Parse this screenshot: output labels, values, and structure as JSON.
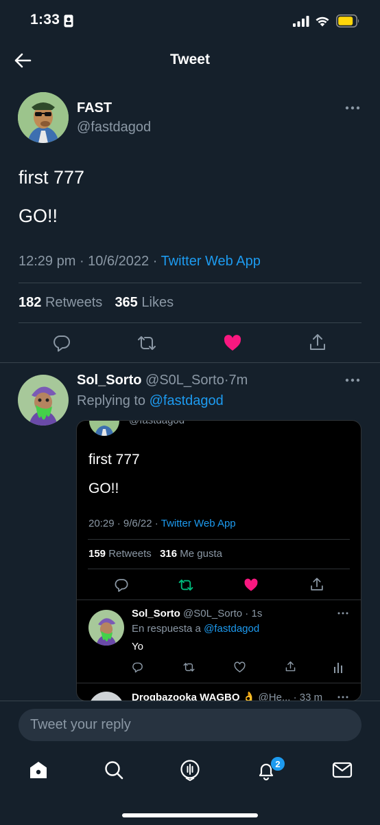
{
  "status_bar": {
    "time": "1:33"
  },
  "header": {
    "title": "Tweet"
  },
  "main_tweet": {
    "display_name": "FAST",
    "handle": "@fastdagod",
    "text_line1": "first 777",
    "text_line2": "GO!!",
    "time": "12:29 pm",
    "date": "10/6/2022",
    "source": "Twitter Web App",
    "retweets_count": "182",
    "retweets_label": "Retweets",
    "likes_count": "365",
    "likes_label": "Likes",
    "liked": true
  },
  "reply": {
    "display_name": "Sol_Sorto",
    "handle": "@S0L_Sorto",
    "age": "7m",
    "replying_to_label": "Replying to",
    "replying_to_handle": "@fastdagod",
    "embed": {
      "top_handle": "@fastdagod",
      "text_line1": "first 777",
      "text_line2": "GO!!",
      "time": "20:29",
      "date": "9/6/22",
      "source": "Twitter Web App",
      "retweets_count": "159",
      "retweets_label": "Retweets",
      "likes_count": "316",
      "likes_label": "Me gusta",
      "inner_reply": {
        "display_name": "Sol_Sorto",
        "handle": "@S0L_Sorto",
        "age": "1s",
        "replying_to_label": "En respuesta a",
        "replying_to_handle": "@fastdagod",
        "text": "Yo"
      },
      "next_reply": {
        "display_name": "Drogbazooka WAGBO",
        "emoji": "👌",
        "handle": "@He...",
        "age": "33 m"
      }
    }
  },
  "reply_box": {
    "placeholder": "Tweet your reply"
  },
  "tab_bar": {
    "notifications_badge": "2"
  },
  "colors": {
    "background": "#15202b",
    "accent": "#1d9bf0",
    "like": "#f91880",
    "retweet_green": "#00ba7c",
    "muted": "#8b98a5"
  },
  "icons": [
    "back-arrow-icon",
    "more-icon",
    "reply-icon",
    "retweet-icon",
    "heart-icon",
    "share-icon",
    "home-icon",
    "search-icon",
    "spaces-icon",
    "bell-icon",
    "mail-icon",
    "analytics-icon"
  ]
}
